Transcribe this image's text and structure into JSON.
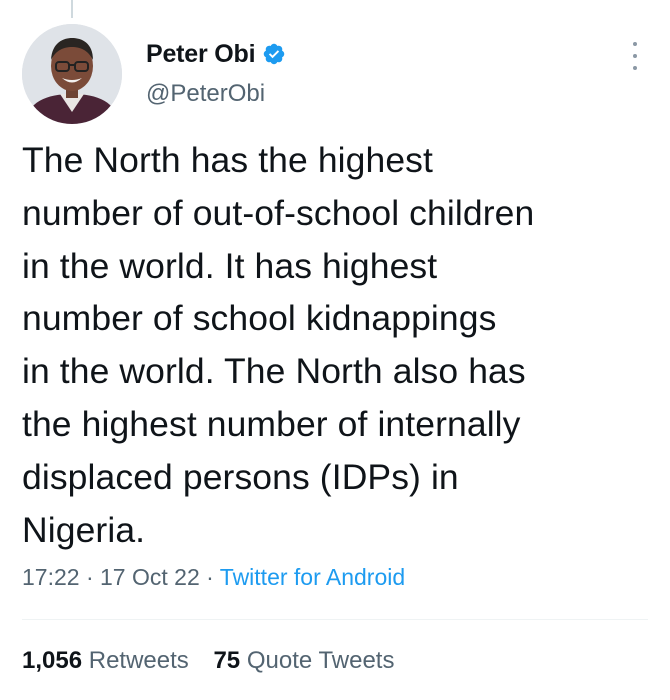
{
  "tweet": {
    "author": {
      "display_name": "Peter Obi",
      "handle": "@PeterObi",
      "verified": true
    },
    "text_lines": [
      "The North has the highest",
      "number of out-of-school children",
      "in the world. It has highest",
      "number of school kidnappings",
      "in the world. The North also has",
      "the highest number of internally",
      "displaced persons (IDPs) in",
      "Nigeria."
    ],
    "time": "17:22",
    "date": "17 Oct 22",
    "source": "Twitter for Android",
    "separator": "·"
  },
  "stats": {
    "retweets_count": "1,056",
    "retweets_label": "Retweets",
    "quotes_count": "75",
    "quotes_label": "Quote Tweets"
  },
  "icons": {
    "verified": "verified-badge-icon",
    "more": "more-options-icon"
  },
  "colors": {
    "accent": "#1d9bf0",
    "text": "#0f1419",
    "secondary": "#536471"
  }
}
